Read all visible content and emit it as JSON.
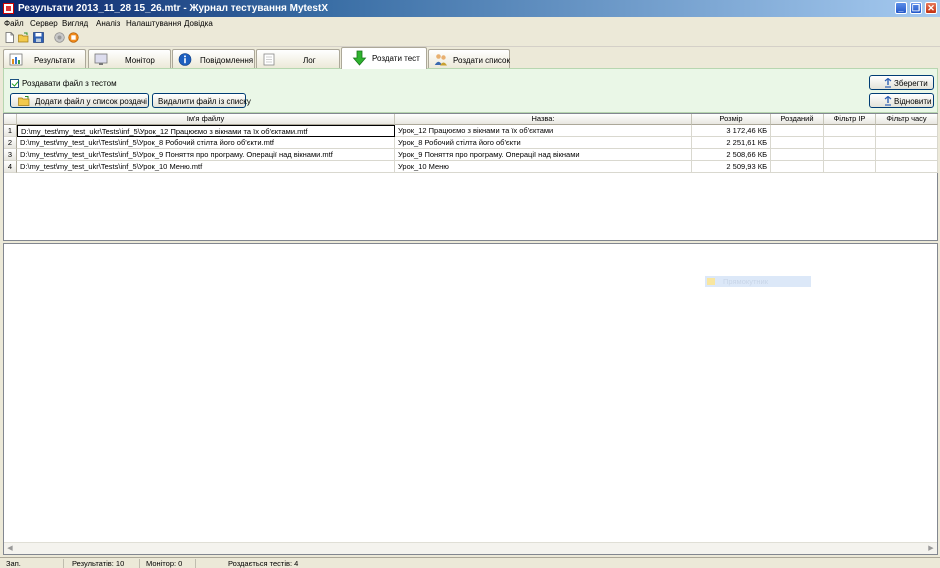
{
  "window": {
    "title": "Результати 2013_11_28 15_26.mtr - Журнал тестування MytestX",
    "minimize_glyph": "_",
    "restore_glyph": "❐",
    "close_glyph": "✕"
  },
  "menu": {
    "items": [
      "Файл",
      "Сервер",
      "Вигляд",
      "Аналіз",
      "Налаштування",
      "Довідка"
    ]
  },
  "toolbar": {
    "icons": [
      "new-file-icon",
      "open-folder-icon",
      "save-icon",
      "record-icon",
      "stop-icon"
    ]
  },
  "tabs": [
    {
      "label": "Результати",
      "icon": "results-icon"
    },
    {
      "label": "Монітор",
      "icon": "monitor-icon"
    },
    {
      "label": "Повідомлення",
      "icon": "info-icon"
    },
    {
      "label": "Лог",
      "icon": "log-icon"
    },
    {
      "label": "Роздати тест",
      "icon": "download-arrow-icon",
      "active": true
    },
    {
      "label": "Роздати список",
      "icon": "users-icon"
    }
  ],
  "distribute": {
    "checkbox_label": "Роздавати файл з тестом",
    "checkbox_checked": true,
    "add_button": "Додати файл у список роздачі",
    "remove_button": "Видалити файл із списку",
    "save_button": "Зберегти",
    "restore_button": "Відновити"
  },
  "grid": {
    "columns": [
      "Ім'я файлу",
      "Назва:",
      "Розмір",
      "Розданий",
      "Фільтр IP",
      "Фільтр часу"
    ],
    "rows": [
      {
        "n": "1",
        "file": "D:\\my_test\\my_test_ukr\\Tests\\inf_5\\Урок_12 Працюємо з вікнами та їх об'єктами.mtf",
        "name": "Урок_12 Працюємо з вікнами та їх об'єктами",
        "size": "3 172,46 КБ",
        "given": "",
        "ip": "",
        "time": ""
      },
      {
        "n": "2",
        "file": "D:\\my_test\\my_test_ukr\\Tests\\inf_5\\Урок_8 Робочий стілта його об'єкти.mtf",
        "name": "Урок_8 Робочий стілта його об'єкти",
        "size": "2 251,61 КБ",
        "given": "",
        "ip": "",
        "time": ""
      },
      {
        "n": "3",
        "file": "D:\\my_test\\my_test_ukr\\Tests\\inf_5\\Урок_9 Поняття про програму. Операції над вікнами.mtf",
        "name": "Урок_9 Поняття про програму. Операції над вікнами",
        "size": "2 508,66 КБ",
        "given": "",
        "ip": "",
        "time": ""
      },
      {
        "n": "4",
        "file": "D:\\my_test\\my_test_ukr\\Tests\\inf_5\\Урок_10 Меню.mtf",
        "name": "Урок_10 Меню",
        "size": "2 509,93 КБ",
        "given": "",
        "ip": "",
        "time": ""
      }
    ]
  },
  "lower": {
    "ghost_text": "Прямокутник"
  },
  "status": {
    "mode": "Зап.",
    "results": "Результатів: 10",
    "monitor": "Монітор: 0",
    "distributed": "Роздається тестів: 4"
  },
  "colors": {
    "panel_bg": "#eaf7e7",
    "titlebar_dark": "#0a246a",
    "titlebar_light": "#a6caf0"
  }
}
